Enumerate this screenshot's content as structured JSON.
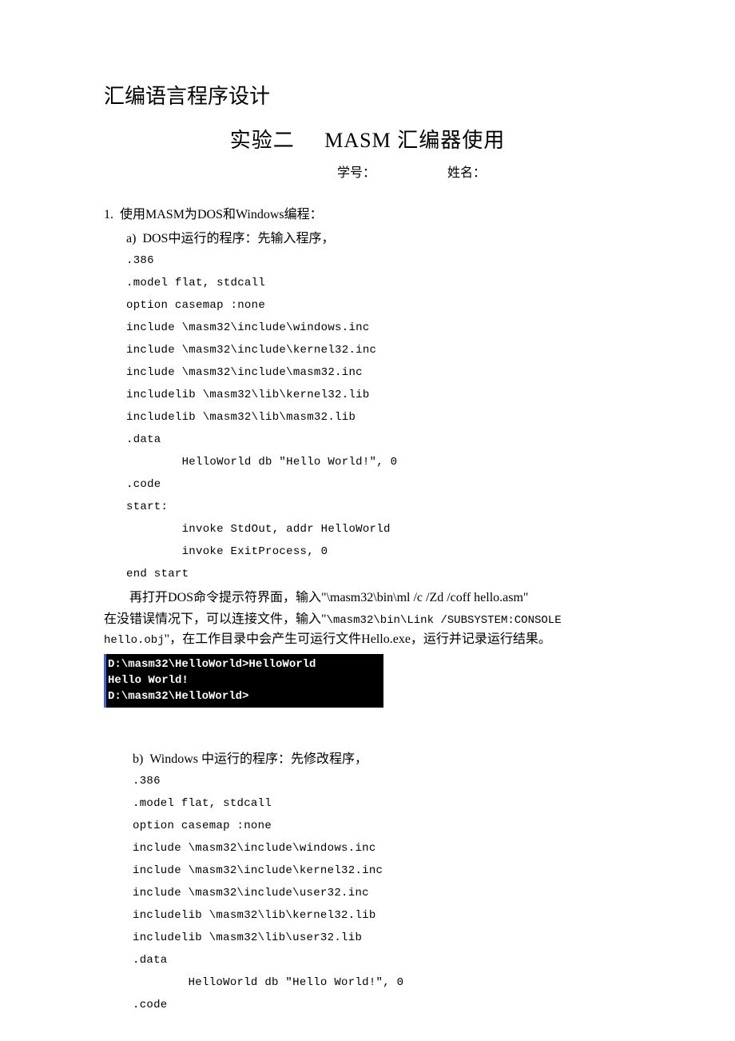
{
  "title_main": "汇编语言程序设计",
  "title_sub_cn1": "实验二",
  "title_sub_en": "MASM",
  "title_sub_cn2": "汇编器使用",
  "info_id_label": "学号：",
  "info_name_label": "姓名：",
  "section1_num": "1.",
  "section1_text_a": "使用",
  "section1_text_b": "MASM",
  "section1_text_c": "为",
  "section1_text_d": "DOS",
  "section1_text_e": "和",
  "section1_text_f": "Windows",
  "section1_text_g": "编程：",
  "sub_a_label": "a)",
  "sub_a_text_a": "DOS",
  "sub_a_text_b": "中运行的程序：先输入程序，",
  "code_a": ".386\n.model flat, stdcall\noption casemap :none\ninclude \\masm32\\include\\windows.inc\ninclude \\masm32\\include\\kernel32.inc\ninclude \\masm32\\include\\masm32.inc\nincludelib \\masm32\\lib\\kernel32.lib\nincludelib \\masm32\\lib\\masm32.lib\n.data\n        HelloWorld db \"Hello World!\", 0\n.code\nstart:\n        invoke StdOut, addr HelloWorld\n        invoke ExitProcess, 0\nend start",
  "para1_a": "再打开",
  "para1_b": "DOS",
  "para1_c": "命令提示符界面，输入\"",
  "para1_d": "\\masm32\\bin\\ml /c /Zd /coff hello.asm",
  "para1_e": "\"",
  "para2_a": "在没错误情况下，可以连接文件，输入\"",
  "para2_b": "\\masm32\\bin\\Link /SUBSYSTEM:CONSOLE hello.obj",
  "para2_c": "\"，在工作目录中会产生可运行文件",
  "para2_d": "Hello.exe",
  "para2_e": "，运行并记录运行结果。",
  "terminal_text": "D:\\masm32\\HelloWorld>HelloWorld\nHello World!\nD:\\masm32\\HelloWorld>",
  "sub_b_label": "b)",
  "sub_b_text_a": "Windows",
  "sub_b_text_b": " 中运行的程序：先修改程序，",
  "code_b": ".386\n.model flat, stdcall\noption casemap :none\ninclude \\masm32\\include\\windows.inc\ninclude \\masm32\\include\\kernel32.inc\ninclude \\masm32\\include\\user32.inc\nincludelib \\masm32\\lib\\kernel32.lib\nincludelib \\masm32\\lib\\user32.lib\n.data\n        HelloWorld db \"Hello World!\", 0\n.code"
}
